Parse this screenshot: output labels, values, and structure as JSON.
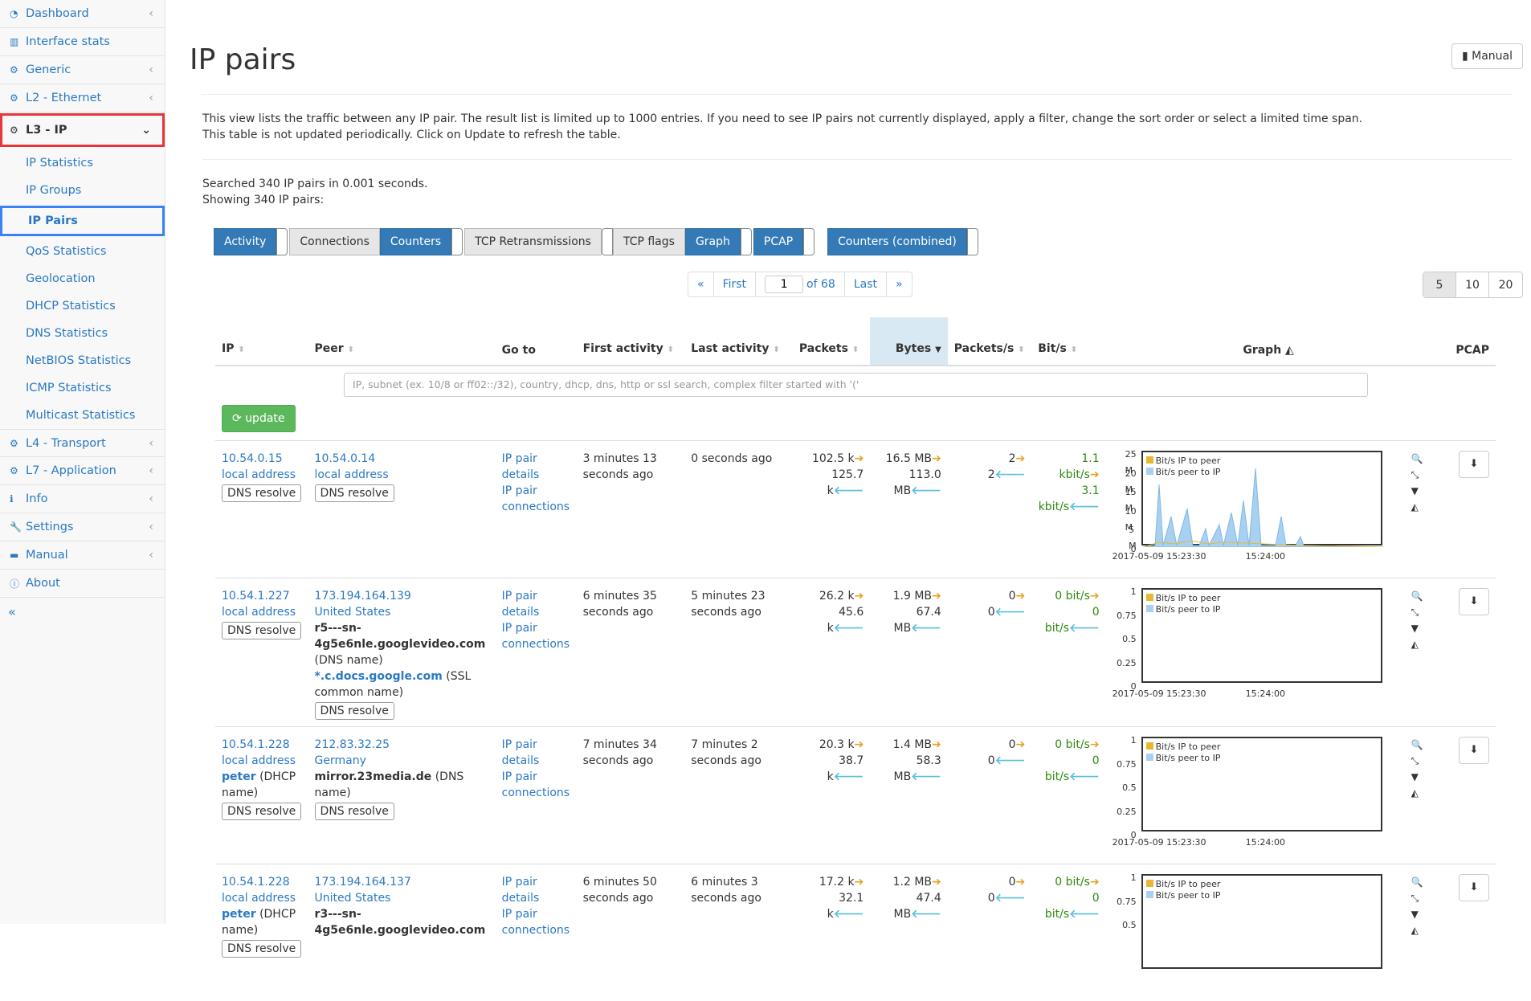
{
  "sidebar": {
    "items": [
      {
        "label": "Dashboard",
        "chev": "‹"
      },
      {
        "label": "Interface stats",
        "chev": ""
      },
      {
        "label": "Generic",
        "chev": "‹"
      },
      {
        "label": "L2 - Ethernet",
        "chev": "‹"
      },
      {
        "label": "L3 - IP",
        "chev": "⌄"
      },
      {
        "label": "L4 - Transport",
        "chev": "‹"
      },
      {
        "label": "L7 - Application",
        "chev": "‹"
      },
      {
        "label": "Info",
        "chev": "‹"
      },
      {
        "label": "Settings",
        "chev": "‹"
      },
      {
        "label": "Manual",
        "chev": "‹"
      },
      {
        "label": "About",
        "chev": ""
      }
    ],
    "sub": [
      "IP Statistics",
      "IP Groups",
      "IP Pairs",
      "QoS Statistics",
      "Geolocation",
      "DHCP Statistics",
      "DNS Statistics",
      "NetBIOS Statistics",
      "ICMP Statistics",
      "Multicast Statistics"
    ],
    "collapse": "«"
  },
  "page": {
    "title": "IP pairs",
    "manual": "Manual",
    "desc1": "This view lists the traffic between any IP pair. The result list is limited up to 1000 entries. If you need to see IP pairs not currently displayed, apply a filter, change the sort order or select a limited time span.",
    "desc2": "This table is not updated periodically. Click on Update to refresh the table.",
    "searched": "Searched 340 IP pairs in 0.001 seconds.",
    "showing": "Showing 340 IP pairs:"
  },
  "tabs": [
    "Activity",
    "Connections",
    "Counters",
    "TCP Retransmissions",
    "TCP flags",
    "Graph",
    "PCAP",
    "Counters (combined)"
  ],
  "pager": {
    "prev": "«",
    "first": "First",
    "page": "1",
    "of": "of 68",
    "last": "Last",
    "next": "»"
  },
  "perpage": [
    "5",
    "10",
    "20"
  ],
  "columns": [
    "IP",
    "Peer",
    "Go to",
    "First activity",
    "Last activity",
    "Packets",
    "Bytes",
    "Packets/s",
    "Bit/s",
    "Graph",
    "PCAP"
  ],
  "filter_placeholder": "IP, subnet (ex. 10/8 or ff02::/32), country, dhcp, dns, http or ssl search, complex filter started with '('",
  "update": "update",
  "dns_resolve": "DNS resolve",
  "goto": {
    "a": "IP pair",
    "b": "details",
    "c": "IP pair",
    "d": "connections"
  },
  "graph_legend": {
    "a": "Bit/s IP to peer",
    "b": "Bit/s peer to IP",
    "t1": "2017-05-09 15:23:30",
    "t2": "15:24:00"
  },
  "rows": [
    {
      "ip": "10.54.0.15",
      "ip_sub": "local address",
      "peer": "10.54.0.14",
      "peer_sub": "local address",
      "first": "3 minutes 13 seconds ago",
      "last": "0 seconds ago",
      "pk1": "102.5 k",
      "pk2": "125.7 k",
      "by1": "16.5 MB",
      "by2": "113.0 MB",
      "ps1": "2",
      "ps2": "2",
      "bs1": "1.1 kbit/s",
      "bs2": "3.1 kbit/s",
      "y": [
        "25 M",
        "20 M",
        "15 M",
        "10 M",
        "5 M",
        "0"
      ]
    },
    {
      "ip": "10.54.1.227",
      "ip_sub": "local address",
      "peer": "173.194.164.139",
      "peer_sub": "United States",
      "peer_dns": "r5---sn-4g5e6nle.googlevideo.com",
      "peer_dns_note": "(DNS name)",
      "peer_ssl": "*.c.docs.google.com",
      "peer_ssl_note": "(SSL common name)",
      "first": "6 minutes 35 seconds ago",
      "last": "5 minutes 23 seconds ago",
      "pk1": "26.2 k",
      "pk2": "45.6 k",
      "by1": "1.9 MB",
      "by2": "67.4 MB",
      "ps1": "0",
      "ps2": "0",
      "bs1": "0 bit/s",
      "bs2": "0 bit/s",
      "y": [
        "1",
        "0.75",
        "0.5",
        "0.25",
        "0"
      ]
    },
    {
      "ip": "10.54.1.228",
      "ip_sub": "local address",
      "ip_dhcp": "peter",
      "ip_dhcp_note": "(DHCP name)",
      "peer": "212.83.32.25",
      "peer_sub": "Germany",
      "peer_dns": "mirror.23media.de",
      "peer_dns_note": "(DNS name)",
      "first": "7 minutes 34 seconds ago",
      "last": "7 minutes 2 seconds ago",
      "pk1": "20.3 k",
      "pk2": "38.7 k",
      "by1": "1.4 MB",
      "by2": "58.3 MB",
      "ps1": "0",
      "ps2": "0",
      "bs1": "0 bit/s",
      "bs2": "0 bit/s",
      "y": [
        "1",
        "0.75",
        "0.5",
        "0.25",
        "0"
      ]
    },
    {
      "ip": "10.54.1.228",
      "ip_sub": "local address",
      "ip_dhcp": "peter",
      "ip_dhcp_note": "(DHCP name)",
      "peer": "173.194.164.137",
      "peer_sub": "United States",
      "peer_dns": "r3---sn-4g5e6nle.googlevideo.com",
      "first": "6 minutes 50 seconds ago",
      "last": "6 minutes 3 seconds ago",
      "pk1": "17.2 k",
      "pk2": "32.1 k",
      "by1": "1.2 MB",
      "by2": "47.4 MB",
      "ps1": "0",
      "ps2": "0",
      "bs1": "0 bit/s",
      "bs2": "0 bit/s",
      "y": [
        "1",
        "0.75",
        "0.5"
      ]
    }
  ]
}
